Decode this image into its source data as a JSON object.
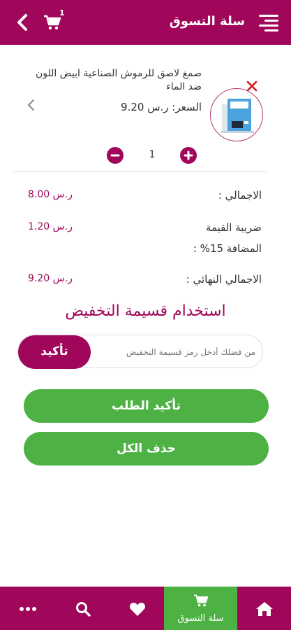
{
  "colors": {
    "brand": "#a0065a",
    "accent_green": "#4db144",
    "divider": "#dddddd"
  },
  "header": {
    "title": "سلة التسوق",
    "cart_badge": "1",
    "icons": {
      "menu": "menu-icon",
      "back": "chevron-left-icon",
      "cart": "cart-icon"
    }
  },
  "cart": {
    "items": [
      {
        "name": "صمغ لاصق للرموش الصناعية ابيض اللون ضد الماء",
        "price_label": "السعر: ر.س 9.20",
        "quantity": "1"
      }
    ]
  },
  "summary": {
    "total_label": "الاجمالي :",
    "total_value": "ر.س 8.00",
    "vat_label": "ضريبة القيمة المضافة 15% :",
    "vat_value": "ر.س 1.20",
    "final_label": "الاجمالي النهائي :",
    "final_value": "ر.س 9.20"
  },
  "coupon": {
    "title": "استخدام قسيمة التخفيض",
    "placeholder": "من فضلك أدخل رمز قسيمة التخفيض",
    "button": "تأكيد"
  },
  "actions": {
    "confirm_order": "تأكيد الطلب",
    "delete_all": "حذف الكل"
  },
  "bottom_nav": {
    "cart_label": "سلة التسوق",
    "items": [
      "home-icon",
      "cart-icon",
      "heart-icon",
      "search-icon",
      "more-icon"
    ]
  }
}
